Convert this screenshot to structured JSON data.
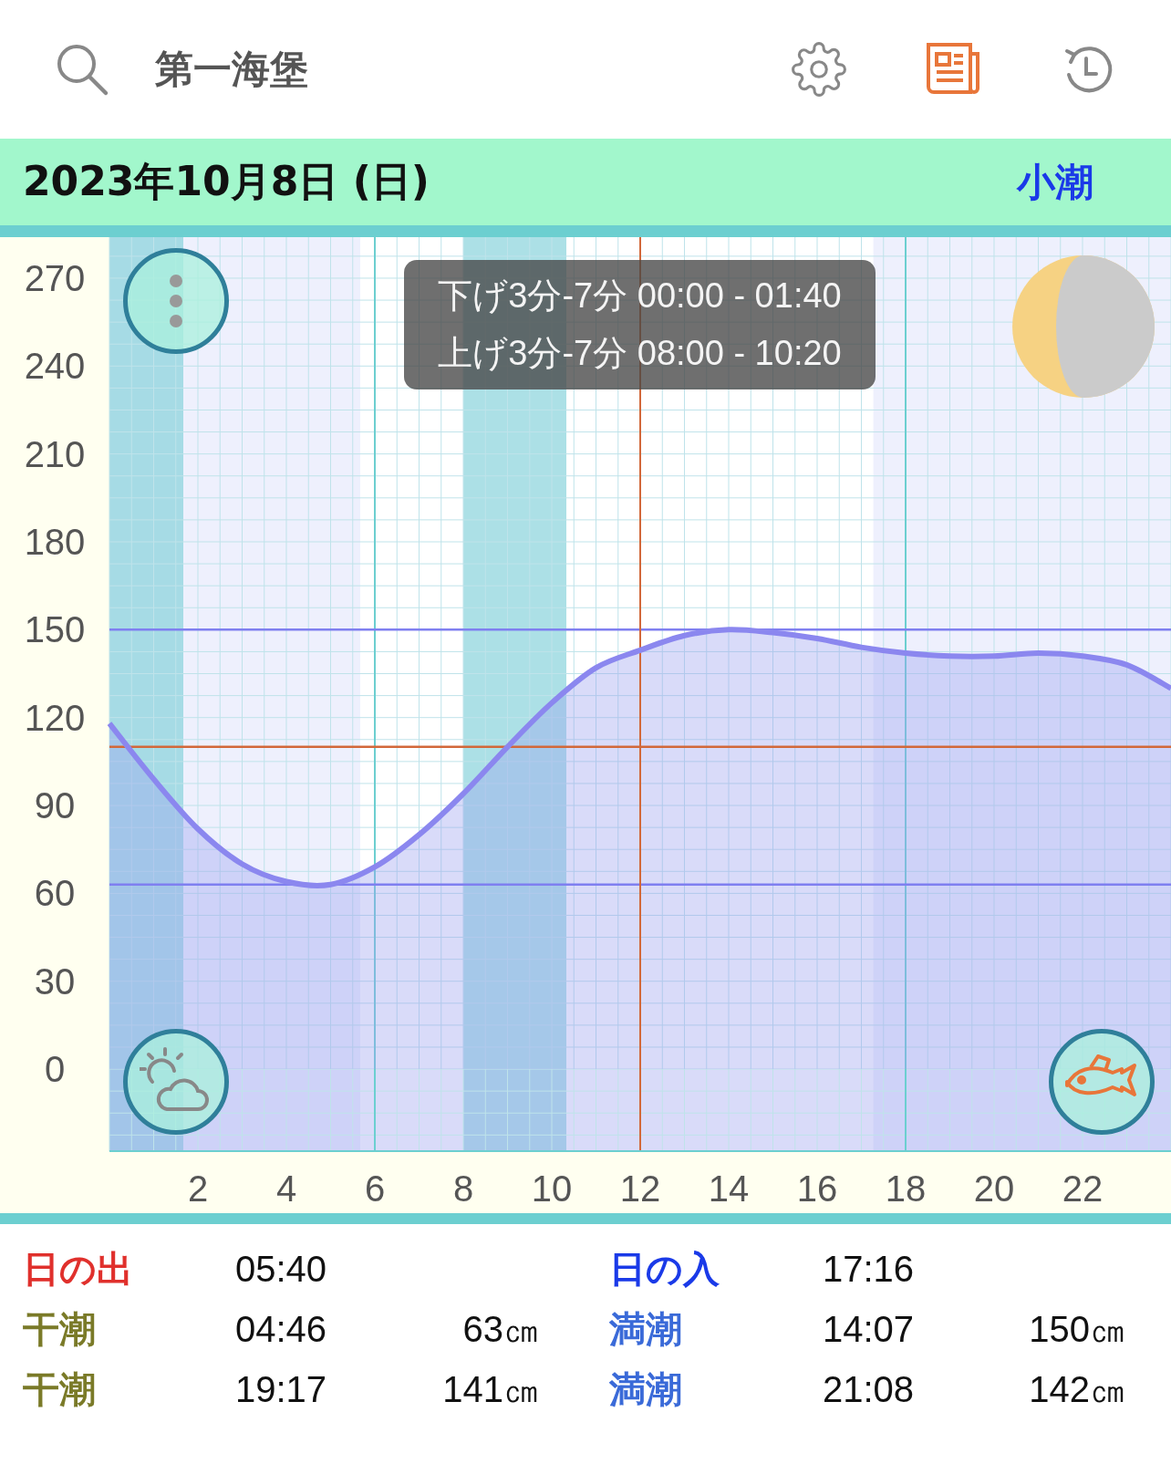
{
  "header": {
    "title": "第一海堡"
  },
  "date_bar": {
    "date": "2023年10月8日 (日)",
    "tide_type": "小潮"
  },
  "tooltip": {
    "lines": [
      "下げ3分-7分 00:00 - 01:40",
      "上げ3分-7分 08:00 - 10:20"
    ]
  },
  "chart": {
    "chart_data": {
      "type": "area",
      "x": [
        0,
        1,
        2,
        3,
        4,
        5,
        6,
        7,
        8,
        9,
        10,
        11,
        12,
        13,
        14,
        15,
        16,
        17,
        18,
        19,
        20,
        21,
        22,
        23,
        24
      ],
      "series": [
        {
          "color": "#8b87ef",
          "values": [
            118,
            99,
            82,
            70,
            64,
            63,
            69,
            80,
            94,
            110,
            125,
            137,
            143,
            148,
            150,
            149,
            147,
            144,
            142,
            141,
            141,
            142,
            141,
            138,
            130
          ]
        }
      ],
      "xlim": [
        0,
        24
      ],
      "ylim": [
        -28,
        284
      ],
      "xticks": [
        2,
        4,
        6,
        8,
        10,
        12,
        14,
        16,
        18,
        20,
        22
      ],
      "yticks": [
        0,
        30,
        60,
        90,
        120,
        150,
        180,
        210,
        240,
        270
      ],
      "grid": true,
      "bands": [
        {
          "axis": "x",
          "from": 0,
          "to": 5.67,
          "color": "#eef0fd"
        },
        {
          "axis": "x",
          "from": 17.27,
          "to": 24,
          "color": "#eef0fd"
        },
        {
          "axis": "x",
          "from": 0,
          "to": 1.67,
          "color": "#7fcfd8"
        },
        {
          "axis": "x",
          "from": 8,
          "to": 10.33,
          "color": "#7fcfd8"
        },
        {
          "axis": "y",
          "from": -28,
          "to": 0,
          "color": "#9aa0f0"
        }
      ],
      "ref_lines": [
        {
          "axis": "y",
          "value": 150,
          "color": "#7f7ff0"
        },
        {
          "axis": "y",
          "value": 63,
          "color": "#7f7ff0"
        },
        {
          "axis": "y",
          "value": 110,
          "color": "#d2683a"
        },
        {
          "axis": "x",
          "value": 12,
          "color": "#d2683a"
        }
      ]
    }
  },
  "events": [
    {
      "kind": "sunrise",
      "label": "日の出",
      "time": "05:40"
    },
    {
      "kind": "sunset",
      "label": "日の入",
      "time": "17:16"
    },
    {
      "kind": "low",
      "label": "干潮",
      "time": "04:46",
      "height": "63㎝"
    },
    {
      "kind": "high",
      "label": "満潮",
      "time": "14:07",
      "height": "150㎝"
    },
    {
      "kind": "low",
      "label": "干潮",
      "time": "19:17",
      "height": "141㎝"
    },
    {
      "kind": "high",
      "label": "満潮",
      "time": "21:08",
      "height": "142㎝"
    }
  ]
}
